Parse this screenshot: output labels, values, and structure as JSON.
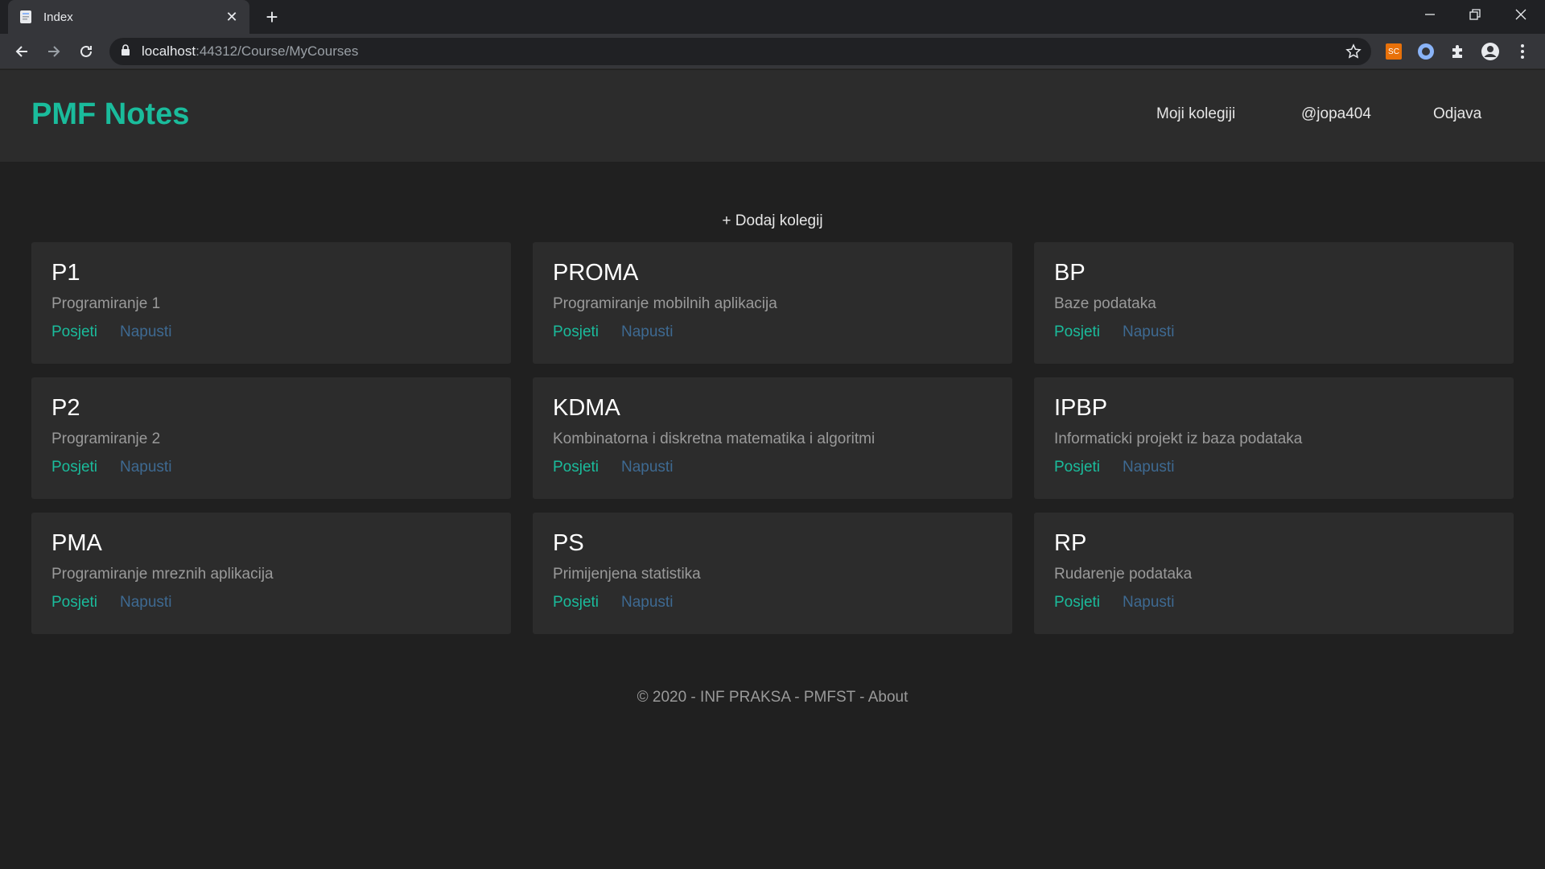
{
  "browser": {
    "tab_title": "Index",
    "url_host": "localhost",
    "url_path": ":44312/Course/MyCourses",
    "extension_label": "SC"
  },
  "navbar": {
    "brand": "PMF Notes",
    "links": [
      "Moji kolegiji",
      "@jopa404",
      "Odjava"
    ]
  },
  "main": {
    "add_course": "+ Dodaj kolegij",
    "courses": [
      {
        "code": "P1",
        "name": "Programiranje 1",
        "visit": "Posjeti",
        "leave": "Napusti"
      },
      {
        "code": "PROMA",
        "name": "Programiranje mobilnih aplikacija",
        "visit": "Posjeti",
        "leave": "Napusti"
      },
      {
        "code": "BP",
        "name": "Baze podataka",
        "visit": "Posjeti",
        "leave": "Napusti"
      },
      {
        "code": "P2",
        "name": "Programiranje 2",
        "visit": "Posjeti",
        "leave": "Napusti"
      },
      {
        "code": "KDMA",
        "name": "Kombinatorna i diskretna matematika i algoritmi",
        "visit": "Posjeti",
        "leave": "Napusti"
      },
      {
        "code": "IPBP",
        "name": "Informaticki projekt iz baza podataka",
        "visit": "Posjeti",
        "leave": "Napusti"
      },
      {
        "code": "PMA",
        "name": "Programiranje mreznih aplikacija",
        "visit": "Posjeti",
        "leave": "Napusti"
      },
      {
        "code": "PS",
        "name": "Primijenjena statistika",
        "visit": "Posjeti",
        "leave": "Napusti"
      },
      {
        "code": "RP",
        "name": "Rudarenje podataka",
        "visit": "Posjeti",
        "leave": "Napusti"
      }
    ]
  },
  "footer": {
    "text": "© 2020 - INF PRAKSA - PMFST - ",
    "about": "About"
  },
  "colors": {
    "accent": "#1abc9c",
    "leave_link": "#3e6a92",
    "page_bg": "#202020",
    "card_bg": "#2c2c2c"
  }
}
